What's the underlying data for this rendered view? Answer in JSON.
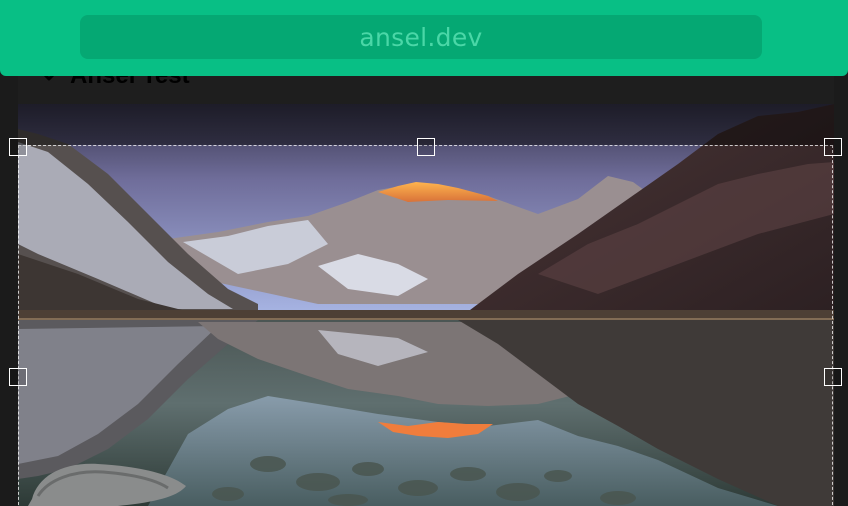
{
  "browser": {
    "url": "ansel.dev"
  },
  "panel": {
    "title": "Ansel Test",
    "expanded_icon": "chevron-down-icon"
  },
  "image": {
    "subject": "mountain-lake-reflection",
    "colors": {
      "sky_top": "#3c3b4c",
      "sky_bottom": "#a9b4e2",
      "alpenglow": "#f29a40",
      "mountain_dark": "#3b2a2b",
      "snow": "#d6d8e4",
      "water": "#3b4642"
    }
  },
  "crop_tool": {
    "handles": [
      "top-left",
      "top-center",
      "top-right",
      "middle-left",
      "middle-right"
    ]
  },
  "theme": {
    "accent": "#08bf85",
    "accent_dark": "#05a873",
    "url_text": "#4ad7a7",
    "page_background": "#1b1b1b"
  }
}
